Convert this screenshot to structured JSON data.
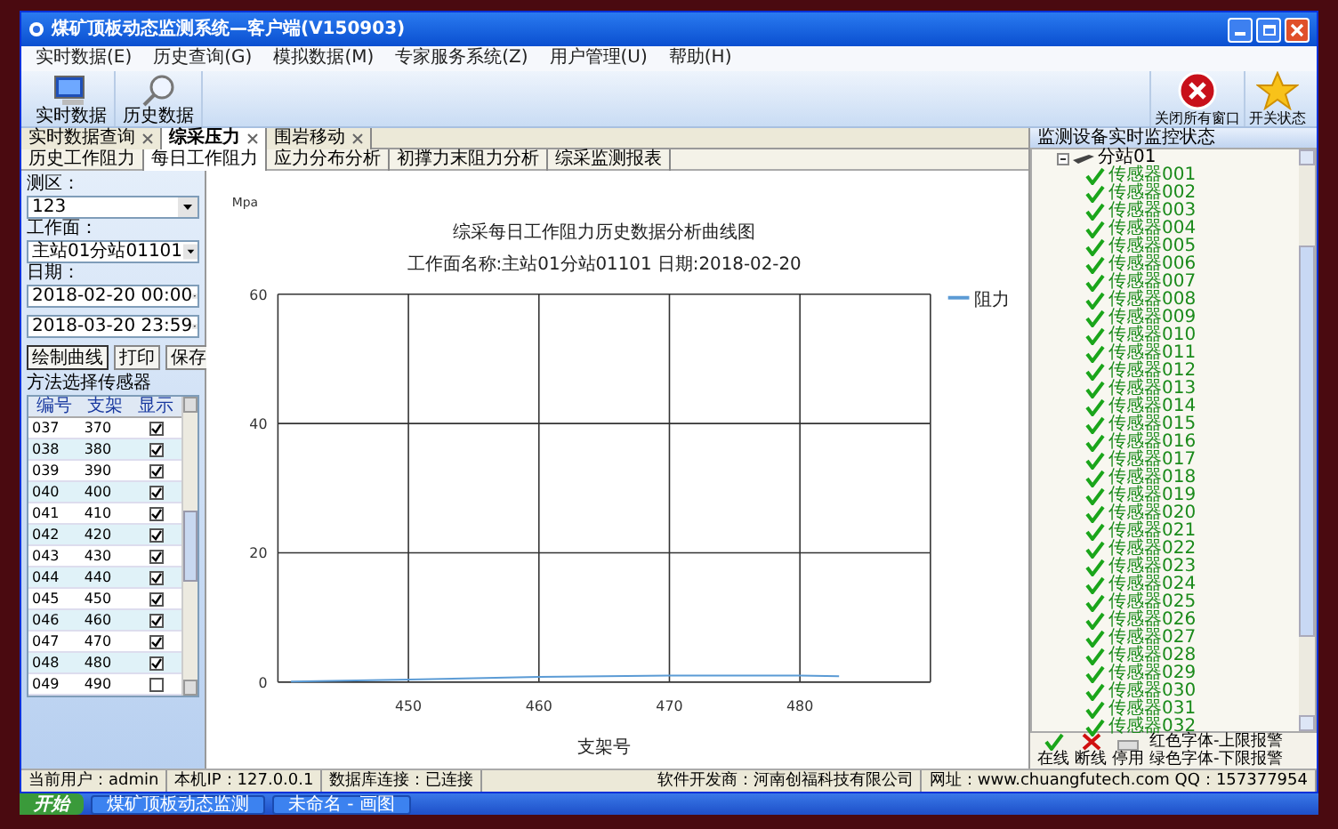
{
  "window": {
    "title": "煤矿顶板动态监测系统—客户端(V150903)"
  },
  "menu": [
    "实时数据(E)",
    "历史查询(G)",
    "模拟数据(M)",
    "专家服务系统(Z)",
    "用户管理(U)",
    "帮助(H)"
  ],
  "toolbar": {
    "left": [
      "实时数据",
      "历史数据"
    ],
    "right": [
      "关闭所有窗口",
      "开关状态"
    ]
  },
  "tabs": [
    {
      "label": "实时数据查询",
      "selected": false
    },
    {
      "label": "综采压力",
      "selected": true
    },
    {
      "label": "围岩移动",
      "selected": false
    }
  ],
  "subtabs": [
    {
      "label": "历史工作阻力",
      "selected": false
    },
    {
      "label": "每日工作阻力",
      "selected": true
    },
    {
      "label": "应力分布分析",
      "selected": false
    },
    {
      "label": "初撑力末阻力分析",
      "selected": false
    },
    {
      "label": "综采监测报表",
      "selected": false
    }
  ],
  "query": {
    "area_label": "测区：",
    "area": "123",
    "face_label": "工作面：",
    "face": "主站01分站01101",
    "date_label": "日期：",
    "start": "2018-02-20 00:00",
    "end": "2018-03-20 23:59",
    "buttons": [
      "绘制曲线",
      "打印",
      "保存"
    ],
    "sensor_title": "方法选择传感器",
    "columns": [
      "编号",
      "支架",
      "显示"
    ],
    "rows": [
      {
        "id": "037",
        "support": "370",
        "checked": true
      },
      {
        "id": "038",
        "support": "380",
        "checked": true
      },
      {
        "id": "039",
        "support": "390",
        "checked": true
      },
      {
        "id": "040",
        "support": "400",
        "checked": true
      },
      {
        "id": "041",
        "support": "410",
        "checked": true
      },
      {
        "id": "042",
        "support": "420",
        "checked": true
      },
      {
        "id": "043",
        "support": "430",
        "checked": true
      },
      {
        "id": "044",
        "support": "440",
        "checked": true
      },
      {
        "id": "045",
        "support": "450",
        "checked": true
      },
      {
        "id": "046",
        "support": "460",
        "checked": true
      },
      {
        "id": "047",
        "support": "470",
        "checked": true
      },
      {
        "id": "048",
        "support": "480",
        "checked": true
      },
      {
        "id": "049",
        "support": "490",
        "checked": false
      }
    ]
  },
  "chart": {
    "unit": "Mpa",
    "chart_data": {
      "type": "line",
      "grid": true,
      "title": "综采每日工作阻力历史数据分析曲线图",
      "subtitle": "工作面名称:主站01分站01101 日期:2018-02-20",
      "xlabel": "支架号",
      "xlim": [
        440,
        490
      ],
      "ylim": [
        0,
        60
      ],
      "xticks": [
        450,
        460,
        470,
        480
      ],
      "yticks": [
        0,
        20,
        40,
        60
      ],
      "x": [
        441,
        450,
        460,
        470,
        480,
        483
      ],
      "series": [
        {
          "name": "阻力",
          "color": "#5b9bd5",
          "values": [
            0.1,
            0.4,
            0.8,
            1.0,
            1.0,
            0.9
          ]
        }
      ]
    }
  },
  "monitor": {
    "title": "监测设备实时监控状态",
    "tree": [
      {
        "label": "分站01",
        "expanded": true,
        "children": [
          {
            "label": "传感器001",
            "kind": "online"
          },
          {
            "label": "传感器002",
            "kind": "online"
          },
          {
            "label": "传感器003",
            "kind": "online"
          },
          {
            "label": "传感器004",
            "kind": "online"
          },
          {
            "label": "传感器005",
            "kind": "online"
          },
          {
            "label": "传感器006",
            "kind": "online"
          },
          {
            "label": "传感器007",
            "kind": "online"
          },
          {
            "label": "传感器008",
            "kind": "online"
          },
          {
            "label": "传感器009",
            "kind": "online"
          },
          {
            "label": "传感器010",
            "kind": "online"
          },
          {
            "label": "传感器011",
            "kind": "online"
          },
          {
            "label": "传感器012",
            "kind": "online"
          },
          {
            "label": "传感器013",
            "kind": "online"
          },
          {
            "label": "传感器014",
            "kind": "online"
          },
          {
            "label": "传感器015",
            "kind": "online"
          },
          {
            "label": "传感器016",
            "kind": "online"
          },
          {
            "label": "传感器017",
            "kind": "online"
          },
          {
            "label": "传感器018",
            "kind": "online"
          },
          {
            "label": "传感器019",
            "kind": "online"
          },
          {
            "label": "传感器020",
            "kind": "online"
          },
          {
            "label": "传感器021",
            "kind": "online"
          },
          {
            "label": "传感器022",
            "kind": "online"
          },
          {
            "label": "传感器023",
            "kind": "online"
          },
          {
            "label": "传感器024",
            "kind": "online"
          },
          {
            "label": "传感器025",
            "kind": "online"
          },
          {
            "label": "传感器026",
            "kind": "online"
          },
          {
            "label": "传感器027",
            "kind": "online"
          },
          {
            "label": "传感器028",
            "kind": "online"
          },
          {
            "label": "传感器029",
            "kind": "online"
          },
          {
            "label": "传感器030",
            "kind": "online"
          },
          {
            "label": "传感器031",
            "kind": "online"
          },
          {
            "label": "传感器032",
            "kind": "online"
          }
        ]
      }
    ],
    "legend": {
      "states": [
        {
          "label": "在线",
          "kind": "online"
        },
        {
          "label": "断线",
          "kind": "offline"
        },
        {
          "label": "停用",
          "kind": "disabled"
        }
      ],
      "notes": [
        "红色字体-上限报警",
        "绿色字体-下限报警"
      ]
    }
  },
  "status_bar": [
    "当前用户：admin",
    "本机IP：127.0.0.1",
    "数据库连接：已连接",
    "软件开发商：河南创福科技有限公司",
    "网址：www.chuangfutech.com QQ：157377954"
  ],
  "taskbar": {
    "start": "开始",
    "tasks": [
      "煤矿顶板动态监测",
      "未命名 - 画图"
    ]
  }
}
